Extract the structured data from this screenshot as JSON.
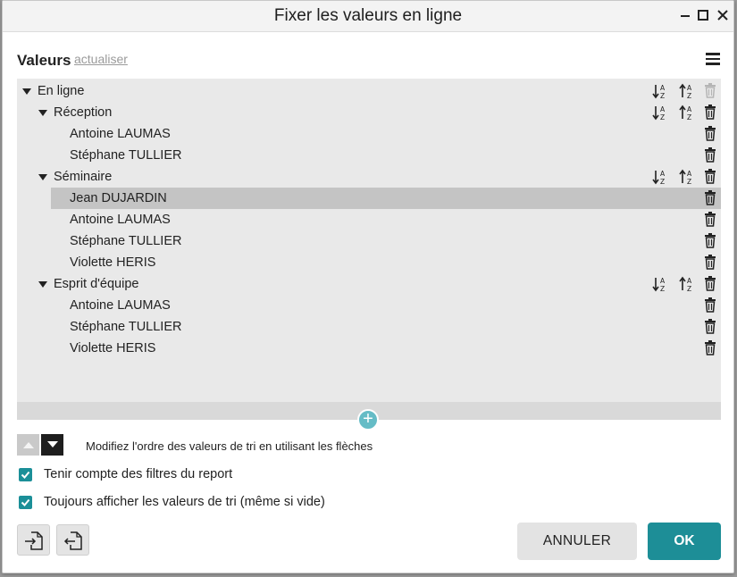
{
  "window": {
    "title": "Fixer les valeurs en ligne"
  },
  "panel": {
    "label": "Valeurs",
    "refresh_link": "actualiser"
  },
  "tree": {
    "root": {
      "label": "En ligne"
    },
    "groups": [
      {
        "label": "Réception",
        "items": [
          "Antoine LAUMAS",
          "Stéphane TULLIER"
        ]
      },
      {
        "label": "Séminaire",
        "items": [
          "Jean DUJARDIN",
          "Antoine LAUMAS",
          "Stéphane TULLIER",
          "Violette HERIS"
        ],
        "selected_item": "Jean DUJARDIN"
      },
      {
        "label": "Esprit d'équipe",
        "items": [
          "Antoine LAUMAS",
          "Stéphane TULLIER",
          "Violette HERIS"
        ]
      }
    ]
  },
  "order_hint": "Modifiez l'ordre des valeurs de tri en utilisant les flèches",
  "options": {
    "filters_label": "Tenir compte des filtres du report",
    "filters_checked": true,
    "show_values_label": "Toujours afficher les valeurs de tri (même si vide)",
    "show_values_checked": true
  },
  "buttons": {
    "cancel": "ANNULER",
    "ok": "OK"
  },
  "colors": {
    "accent": "#1d8e97",
    "add_button": "#65bcc6",
    "selected_row": "#c4c4c4",
    "tree_background": "#e9e9e9"
  }
}
